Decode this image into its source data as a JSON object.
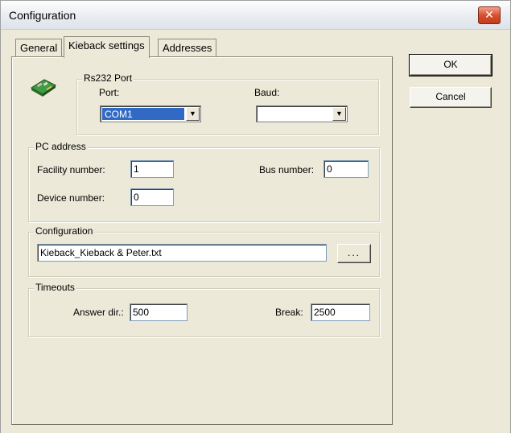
{
  "window": {
    "title": "Configuration",
    "close_glyph": "✕"
  },
  "tabs": [
    {
      "label": "General"
    },
    {
      "label": "Kieback settings"
    },
    {
      "label": "Addresses"
    }
  ],
  "icons": {
    "app": "serial-card-icon",
    "close": "close-icon",
    "dropdown": "chevron-down-icon"
  },
  "rs232": {
    "title": "Rs232 Port",
    "port_label": "Port:",
    "port_value": "COM1",
    "baud_label": "Baud:",
    "baud_value": ""
  },
  "pc_address": {
    "title": "PC address",
    "facility_label": "Facility number:",
    "facility_value": "1",
    "bus_label": "Bus number:",
    "bus_value": "0",
    "device_label": "Device number:",
    "device_value": "0"
  },
  "configuration": {
    "title": "Configuration",
    "file_value": "Kieback_Kieback & Peter.txt",
    "browse_label": "..."
  },
  "timeouts": {
    "title": "Timeouts",
    "answer_label": "Answer dir.:",
    "answer_value": "500",
    "break_label": "Break:",
    "break_value": "2500"
  },
  "buttons": {
    "ok": "OK",
    "cancel": "Cancel"
  },
  "colors": {
    "selection": "#316ac5",
    "dialog_bg": "#ece9d8",
    "close_red": "#d9502f"
  }
}
